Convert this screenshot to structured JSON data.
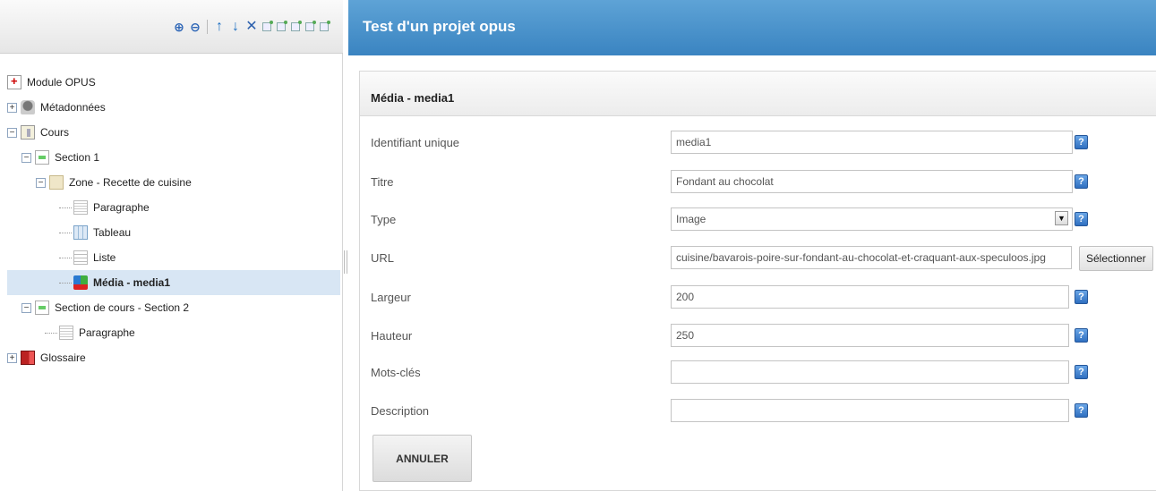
{
  "header": {
    "title": "Test d'un projet opus"
  },
  "toolbar": {
    "icons": [
      "zoom-in-icon",
      "zoom-out-icon",
      "move-up-icon",
      "move-down-icon",
      "delete-icon",
      "copy-icon",
      "add-node-icon",
      "link-node-icon",
      "add-child-icon",
      "add-sibling-icon"
    ]
  },
  "tree": {
    "items": [
      {
        "label": "Module OPUS",
        "icon": "module-icon"
      },
      {
        "label": "Métadonnées",
        "icon": "metadata-icon"
      },
      {
        "label": "Cours",
        "icon": "course-icon"
      },
      {
        "label": "Section 1",
        "icon": "section-icon"
      },
      {
        "label": "Zone - Recette de cuisine",
        "icon": "zone-icon"
      },
      {
        "label": "Paragraphe",
        "icon": "paragraph-icon"
      },
      {
        "label": "Tableau",
        "icon": "table-icon"
      },
      {
        "label": "Liste",
        "icon": "list-icon"
      },
      {
        "label": "Média - media1",
        "icon": "media-icon",
        "selected": true
      },
      {
        "label": "Section de cours - Section 2",
        "icon": "section-icon"
      },
      {
        "label": "Paragraphe",
        "icon": "paragraph-icon"
      },
      {
        "label": "Glossaire",
        "icon": "glossary-icon"
      }
    ]
  },
  "form": {
    "title": "Média - media1",
    "fields": {
      "identifiant": {
        "label": "Identifiant unique",
        "value": "media1"
      },
      "titre": {
        "label": "Titre",
        "value": "Fondant au chocolat"
      },
      "type": {
        "label": "Type",
        "value": "Image"
      },
      "url": {
        "label": "URL",
        "value": "cuisine/bavarois-poire-sur-fondant-au-chocolat-et-craquant-aux-speculoos.jpg",
        "button": "Sélectionner"
      },
      "largeur": {
        "label": "Largeur",
        "value": "200"
      },
      "hauteur": {
        "label": "Hauteur",
        "value": "250"
      },
      "motscles": {
        "label": "Mots-clés",
        "value": ""
      },
      "description": {
        "label": "Description",
        "value": ""
      }
    },
    "help_label": "?",
    "cancel_label": "ANNULER"
  }
}
